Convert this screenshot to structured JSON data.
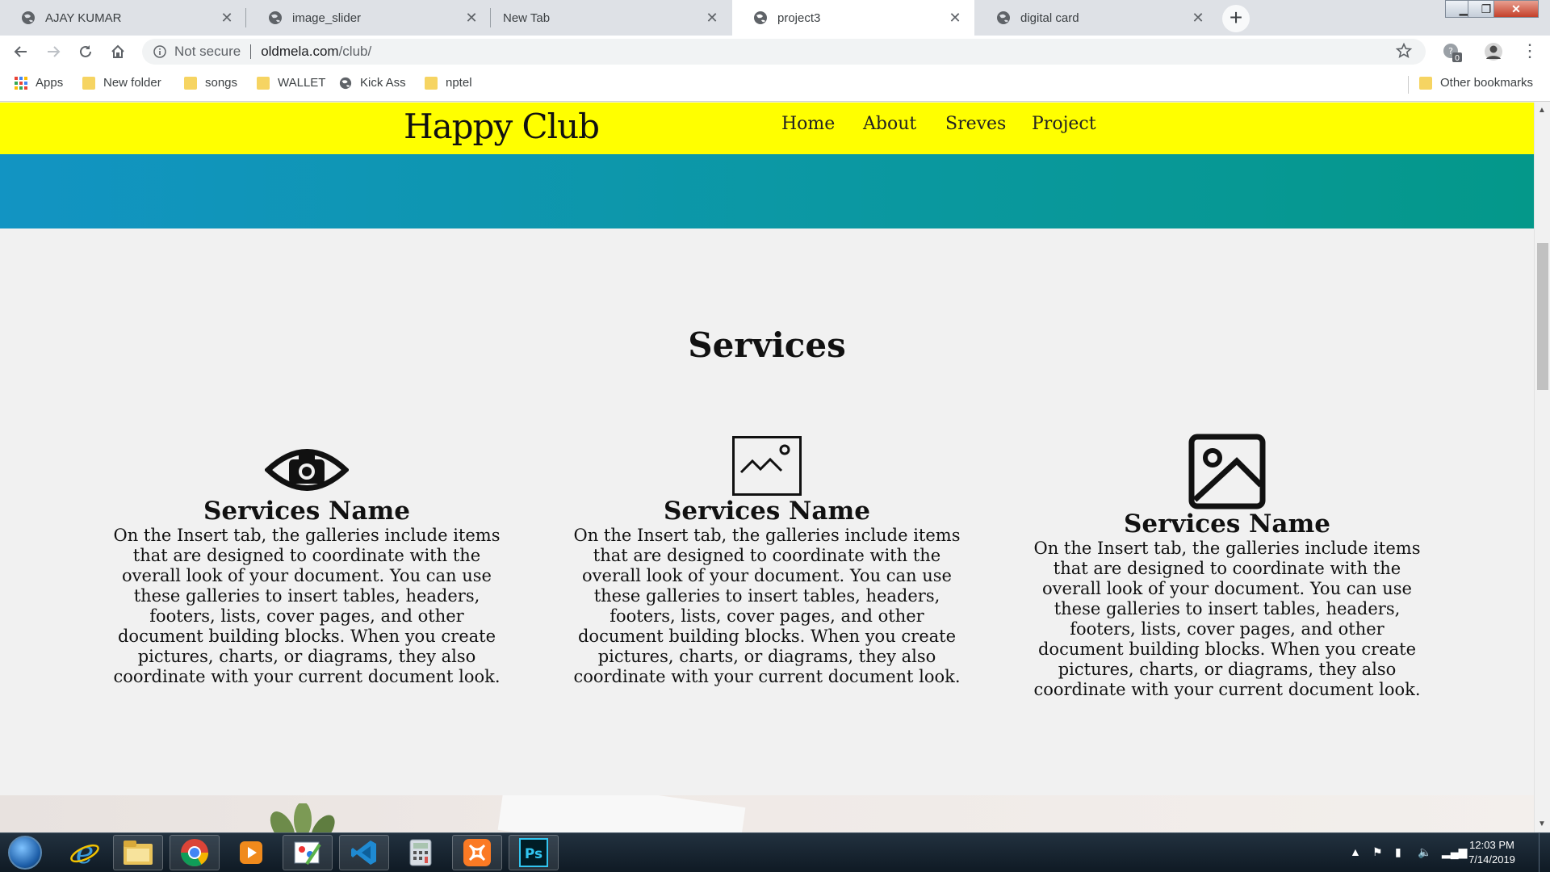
{
  "browser": {
    "tabs": [
      {
        "title": "AJAY KUMAR",
        "active": false
      },
      {
        "title": "image_slider",
        "active": false
      },
      {
        "title": "New Tab",
        "active": false
      },
      {
        "title": "project3",
        "active": true
      },
      {
        "title": "digital card",
        "active": false
      }
    ],
    "new_tab_icon": "plus-icon",
    "window_controls": [
      "minimize",
      "maximize",
      "close"
    ],
    "address": {
      "security_label": "Not secure",
      "host": "oldmela.com",
      "path": "/club/"
    },
    "bookmarks": [
      {
        "label": "Apps",
        "icon": "apps-grid-icon"
      },
      {
        "label": "New folder",
        "icon": "folder-icon"
      },
      {
        "label": "songs",
        "icon": "folder-icon"
      },
      {
        "label": "WALLET",
        "icon": "folder-icon"
      },
      {
        "label": "Kick Ass",
        "icon": "globe-icon"
      },
      {
        "label": "nptel",
        "icon": "folder-icon"
      }
    ],
    "other_bookmarks": "Other bookmarks",
    "extension_badge": "0"
  },
  "site": {
    "logo": "Happy Club",
    "nav": [
      "Home",
      "About",
      "Sreves",
      "Project"
    ],
    "header_color": "#ffff00",
    "hero_gradient": [
      "#1294c3",
      "#04988a"
    ],
    "services_title": "Services",
    "services": [
      {
        "icon": "eye-camera-icon",
        "name": "Services Name",
        "text": "On the Insert tab, the galleries include items that are designed to coordinate with the overall look of your document. You can use these galleries to insert tables, headers, footers, lists, cover pages, and other document building blocks. When you create pictures, charts, or diagrams, they also coordinate with your current document look."
      },
      {
        "icon": "landscape-icon",
        "name": "Services Name",
        "text": "On the Insert tab, the galleries include items that are designed to coordinate with the overall look of your document. You can use these galleries to insert tables, headers, footers, lists, cover pages, and other document building blocks. When you create pictures, charts, or diagrams, they also coordinate with your current document look."
      },
      {
        "icon": "image-icon",
        "name": "Services Name",
        "text": "On the Insert tab, the galleries include items that are designed to coordinate with the overall look of your document. You can use these galleries to insert tables, headers, footers, lists, cover pages, and other document building blocks. When you create pictures, charts, or diagrams, they also coordinate with your current document look."
      }
    ]
  },
  "taskbar": {
    "apps": [
      "internet-explorer-icon",
      "file-explorer-icon",
      "chrome-icon",
      "media-player-icon",
      "paint-icon",
      "vscode-icon",
      "calculator-icon",
      "xampp-icon",
      "photoshop-icon"
    ],
    "photoshop_label": "Ps",
    "time": "12:03 PM",
    "date": "7/14/2019"
  }
}
